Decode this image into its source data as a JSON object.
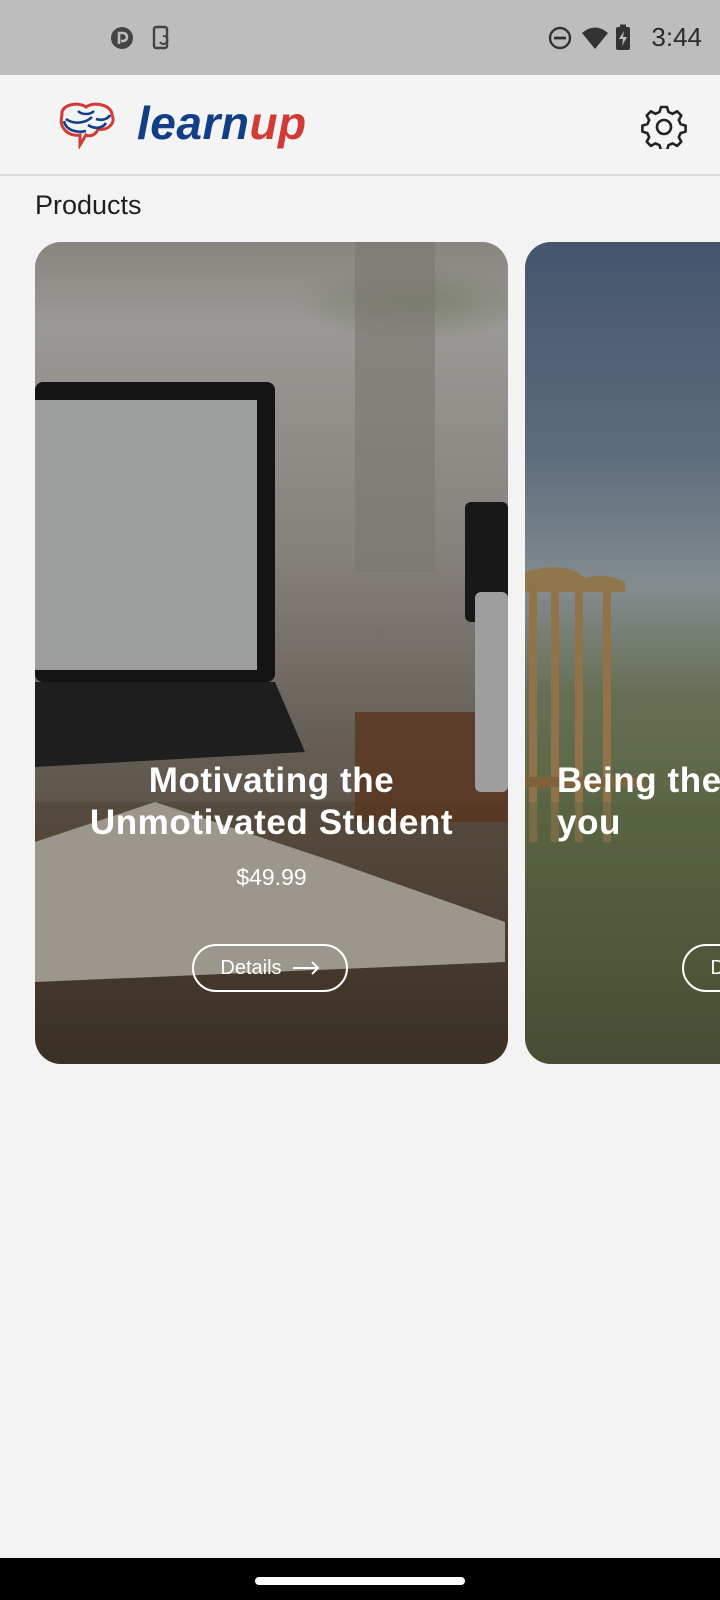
{
  "status_bar": {
    "time": "3:44",
    "icons": [
      "pocket-casts-icon",
      "screen-rotate-icon",
      "do-not-disturb-icon",
      "wifi-icon",
      "battery-charging-icon"
    ]
  },
  "app_bar": {
    "logo_learn": "learn",
    "logo_up": "up",
    "settings_icon": "gear-icon"
  },
  "colors": {
    "brand_blue": "#123e88",
    "brand_red": "#d23a35",
    "background": "#f3f3f3"
  },
  "products": {
    "title": "Products",
    "cards": [
      {
        "title": "Motivating the Unmotivated Student",
        "price": "$49.99",
        "details_label": "Details"
      },
      {
        "title": "Being the you",
        "price": "",
        "details_label": "Details"
      }
    ]
  }
}
